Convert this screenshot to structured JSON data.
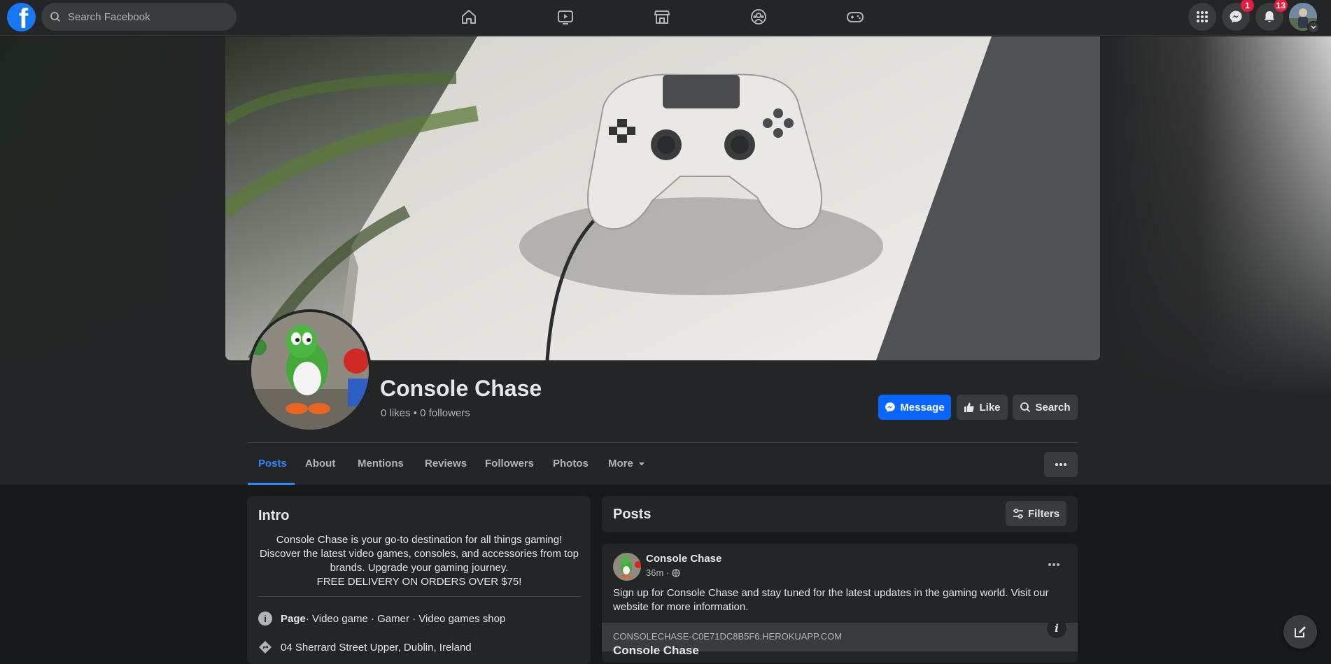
{
  "topbar": {
    "logo_letter": "f",
    "search_placeholder": "Search Facebook",
    "nav_icons": [
      "home-icon",
      "watch-icon",
      "marketplace-icon",
      "groups-icon",
      "gaming-icon"
    ],
    "messenger_badge": "1",
    "notifications_badge": "13"
  },
  "page": {
    "name": "Console Chase",
    "meta": "0 likes • 0 followers",
    "actions": {
      "message": "Message",
      "like": "Like",
      "search": "Search"
    },
    "tabs": [
      "Posts",
      "About",
      "Mentions",
      "Reviews",
      "Followers",
      "Photos",
      "More"
    ],
    "active_tab": "Posts"
  },
  "intro": {
    "title": "Intro",
    "bio_lines": [
      "Console Chase is your go-to destination for all things gaming!",
      "Discover the latest video games, consoles, and accessories from top",
      "brands. Upgrade your gaming journey.",
      "FREE DELIVERY ON ORDERS OVER $75!"
    ],
    "category_label": "Page",
    "category_rest": " · Video game · Gamer · Video games shop",
    "address": "04 Sherrard Street Upper, Dublin, Ireland"
  },
  "posts": {
    "title": "Posts",
    "filters_label": "Filters",
    "post": {
      "author": "Console Chase",
      "time": "36m ·",
      "text": "Sign up for Console Chase and stay tuned for the latest updates in the gaming world. Visit our website for more information.",
      "link_domain": "CONSOLECHASE-C0E71DC8B5F6.HEROKUAPP.COM",
      "link_title": "Console Chase"
    }
  },
  "colors": {
    "accent": "#0866ff",
    "active_tab": "#2d88ff",
    "badge": "#e41e3f"
  }
}
